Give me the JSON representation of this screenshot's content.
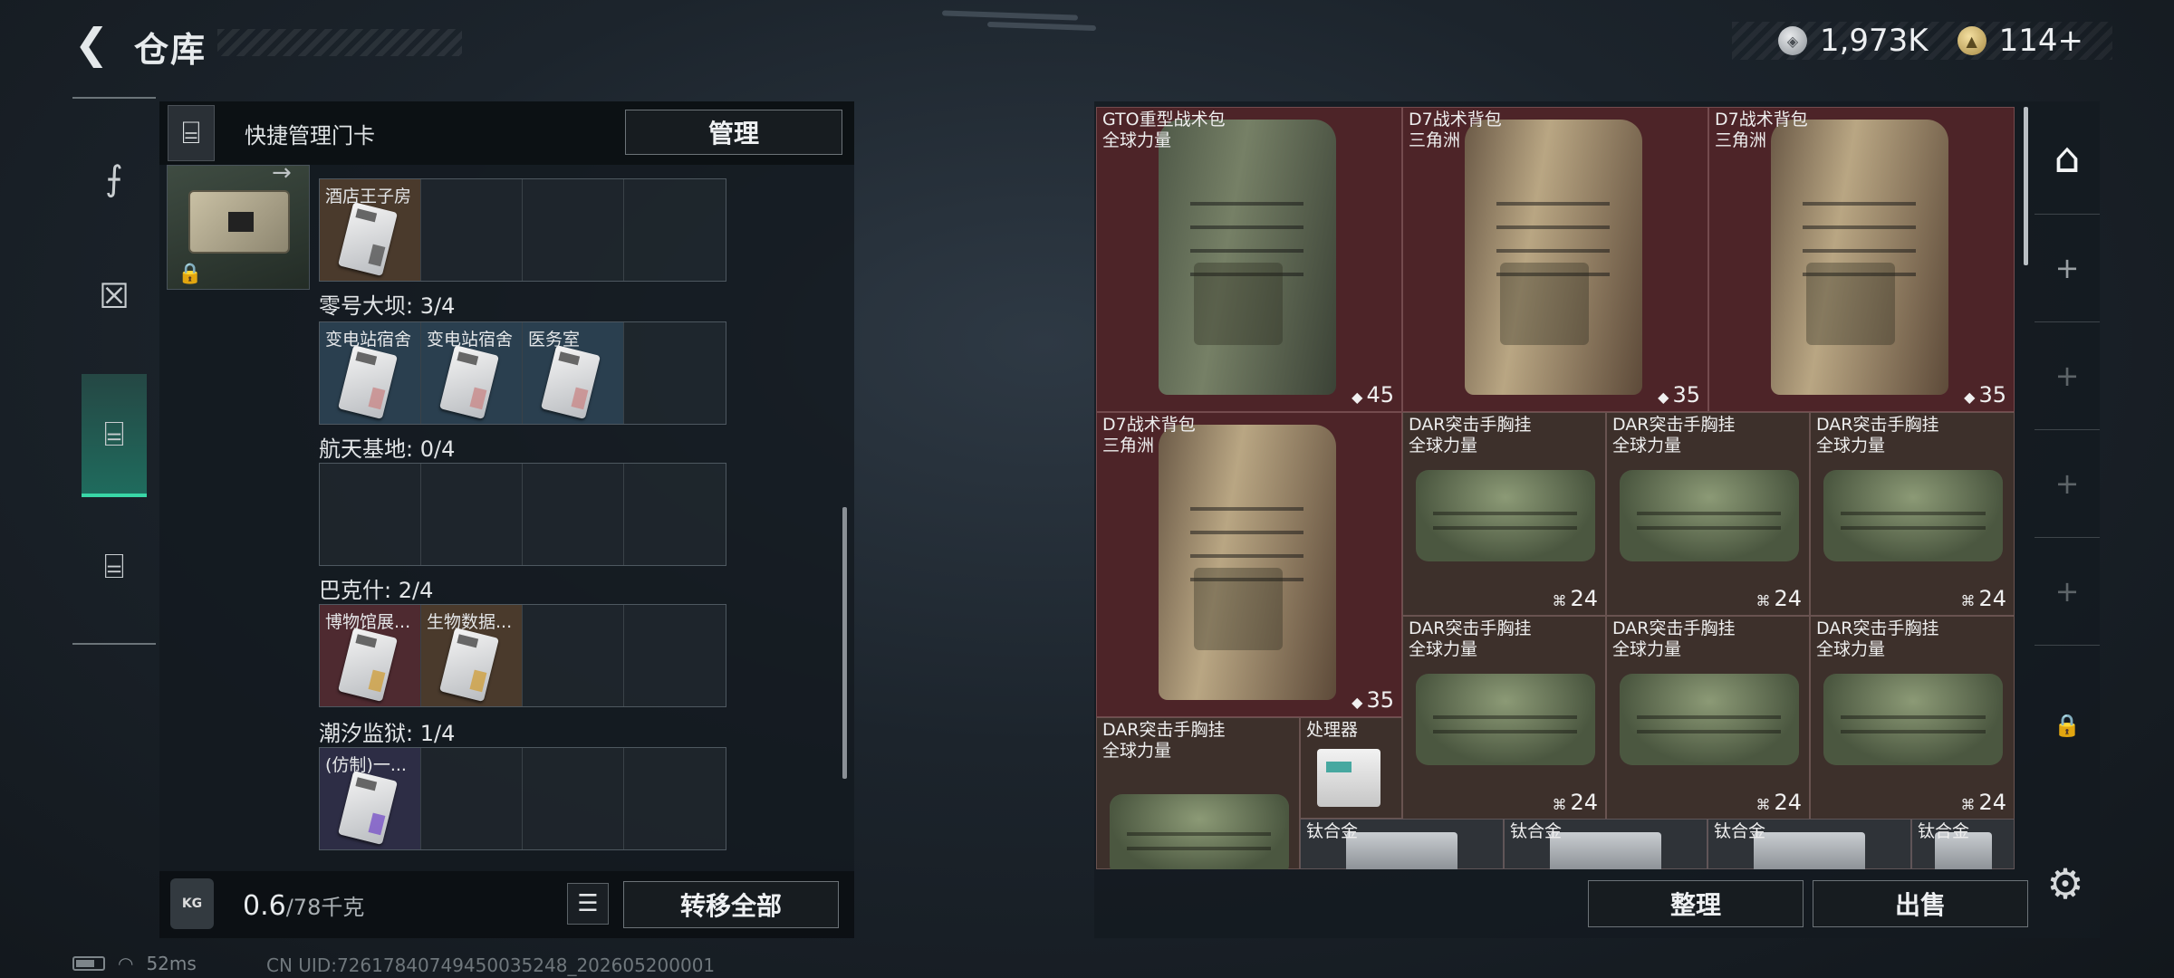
{
  "header": {
    "title": "仓库",
    "currency_silver": "1,973K",
    "currency_gold": "114+"
  },
  "left_nav": {
    "items": [
      "weapons",
      "gear",
      "keycards",
      "toolbox"
    ],
    "active": "keycards"
  },
  "quick_manage": {
    "label": "快捷管理门卡",
    "manage_button": "管理"
  },
  "keycard_groups": [
    {
      "label": "",
      "slots": [
        {
          "name": "酒店王子房",
          "tone": "brown",
          "card": "bio"
        },
        null,
        null,
        null
      ]
    },
    {
      "label": "零号大坝: 3/4",
      "slots": [
        {
          "name": "变电站宿舍",
          "tone": "blue",
          "card": "pink"
        },
        {
          "name": "变电站宿舍",
          "tone": "blue",
          "card": "pink"
        },
        {
          "name": "医务室",
          "tone": "blue",
          "card": "pink"
        },
        null
      ]
    },
    {
      "label": "航天基地: 0/4",
      "slots": [
        null,
        null,
        null,
        null
      ]
    },
    {
      "label": "巴克什: 2/4",
      "slots": [
        {
          "name": "博物馆展...",
          "tone": "red",
          "card": "gold"
        },
        {
          "name": "生物数据...",
          "tone": "brown",
          "card": "gold"
        },
        null,
        null
      ]
    },
    {
      "label": "潮汐监狱: 1/4",
      "slots": [
        {
          "name": "(仿制)一...",
          "tone": "purple",
          "card": "purple"
        },
        null,
        null,
        null
      ]
    }
  ],
  "bottom_left": {
    "weight_current": "0.6",
    "weight_capacity": "/78千克",
    "kg_icon": "KG",
    "transfer_all": "转移全部"
  },
  "warehouse_items": [
    {
      "name": "GTO重型战术包",
      "sub": "全球力量",
      "count": "45",
      "kind": "backpack-green",
      "tone": "red"
    },
    {
      "name": "D7战术背包",
      "sub": "三角洲",
      "count": "35",
      "kind": "backpack-tan",
      "tone": "red"
    },
    {
      "name": "D7战术背包",
      "sub": "三角洲",
      "count": "35",
      "kind": "backpack-tan",
      "tone": "red"
    },
    {
      "name": "D7战术背包",
      "sub": "三角洲",
      "count": "35",
      "kind": "backpack-tan",
      "tone": "red"
    },
    {
      "name": "DAR突击手胸挂",
      "sub": "全球力量",
      "count": "24",
      "kind": "rig",
      "tone": "brown"
    },
    {
      "name": "DAR突击手胸挂",
      "sub": "全球力量",
      "count": "24",
      "kind": "rig",
      "tone": "brown"
    },
    {
      "name": "DAR突击手胸挂",
      "sub": "全球力量",
      "count": "24",
      "kind": "rig",
      "tone": "brown"
    },
    {
      "name": "DAR突击手胸挂",
      "sub": "全球力量",
      "count": "24",
      "kind": "rig",
      "tone": "brown"
    },
    {
      "name": "DAR突击手胸挂",
      "sub": "全球力量",
      "count": "24",
      "kind": "rig",
      "tone": "brown"
    },
    {
      "name": "DAR突击手胸挂",
      "sub": "全球力量",
      "count": "24",
      "kind": "rig",
      "tone": "brown"
    },
    {
      "name": "DAR突击手胸挂",
      "sub": "全球力量",
      "count": "",
      "kind": "rig",
      "tone": "brown"
    },
    {
      "name": "处理器",
      "sub": "",
      "count": "",
      "kind": "device",
      "tone": "brown"
    },
    {
      "name": "钛合金",
      "sub": "",
      "count": "",
      "kind": "ingot",
      "tone": "gray"
    },
    {
      "name": "钛合金",
      "sub": "",
      "count": "",
      "kind": "ingot",
      "tone": "gray"
    },
    {
      "name": "钛合金",
      "sub": "",
      "count": "",
      "kind": "ingot",
      "tone": "gray"
    },
    {
      "name": "钛合金",
      "sub": "",
      "count": "",
      "kind": "ingot",
      "tone": "gray"
    }
  ],
  "right_side_buttons": [
    "warehouse-tab",
    "add",
    "add",
    "add",
    "add",
    "locked"
  ],
  "bottom_right": {
    "sort_button": "整理",
    "sell_button": "出售"
  },
  "status": {
    "ping": "52ms",
    "uid": "CN UID:7261784074945003524​8_202605200001"
  }
}
